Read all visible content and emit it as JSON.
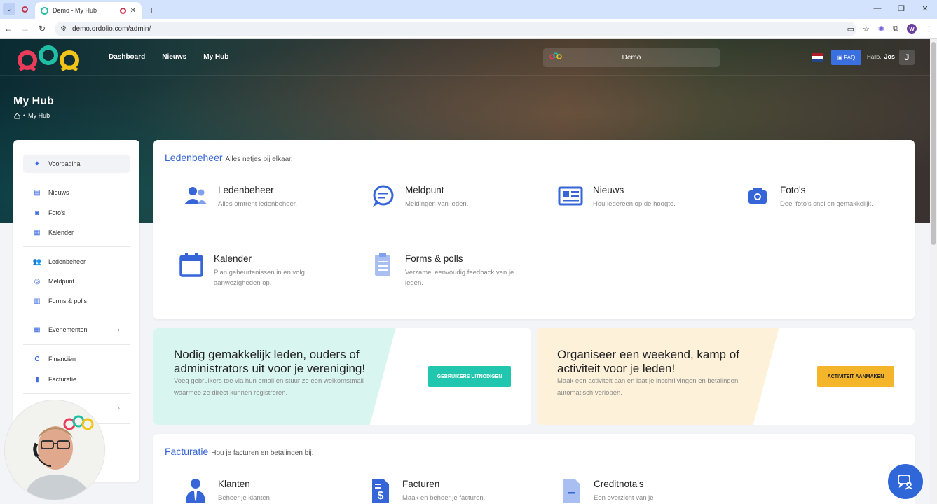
{
  "browser": {
    "tab_title": "Demo - My Hub",
    "url": "demo.ordolio.com/admin/",
    "profile_initial": "W"
  },
  "topnav": {
    "links": [
      "Dashboard",
      "Nieuws",
      "My Hub"
    ],
    "org_selector": "Demo",
    "faq_label": "FAQ",
    "greeting": "Hallo,",
    "username": "Jos",
    "user_initial": "J"
  },
  "page": {
    "title": "My Hub",
    "breadcrumb": "My Hub"
  },
  "sidebar": {
    "items": [
      {
        "label": "Voorpagina",
        "icon": "sparkle-icon"
      },
      {
        "label": "Nieuws",
        "icon": "newspaper-icon"
      },
      {
        "label": "Foto's",
        "icon": "camera-icon"
      },
      {
        "label": "Kalender",
        "icon": "calendar-icon"
      },
      {
        "label": "Ledenbeheer",
        "icon": "users-icon"
      },
      {
        "label": "Meldpunt",
        "icon": "chat-icon"
      },
      {
        "label": "Forms & polls",
        "icon": "clipboard-icon"
      },
      {
        "label": "Evenementen",
        "icon": "calendar-icon"
      },
      {
        "label": "Financiën",
        "icon": "coin-icon"
      },
      {
        "label": "Facturatie",
        "icon": "invoice-icon"
      }
    ]
  },
  "ledenbeheer_card": {
    "title": "Ledenbeheer",
    "subtitle": "Alles netjes bij elkaar.",
    "tiles": [
      {
        "title": "Ledenbeheer",
        "desc": "Alles omtrent ledenbeheer."
      },
      {
        "title": "Meldpunt",
        "desc": "Meldingen van leden."
      },
      {
        "title": "Nieuws",
        "desc": "Hou iedereen op de hoogte."
      },
      {
        "title": "Foto's",
        "desc": "Deel foto's snel en gemakkelijk."
      },
      {
        "title": "Kalender",
        "desc": "Plan gebeurtenissen in en volg aanwezigheden op."
      },
      {
        "title": "Forms & polls",
        "desc": "Verzamel eenvoudig feedback van je leden."
      }
    ]
  },
  "promo_invite": {
    "heading": "Nodig gemakkelijk leden, ouders of administrators uit voor je vereniging!",
    "text": "Voeg gebruikers toe via hun email en stuur ze een welkomstmail waarmee ze direct kunnen registreren.",
    "button": "GEBRUIKERS UITNODIGEN",
    "color": "#20c6ad"
  },
  "promo_activity": {
    "heading": "Organiseer een weekend, kamp of activiteit voor je leden!",
    "text": "Maak een activiteit aan en laat je inschrijvingen en betalingen automatisch verlopen.",
    "button": "ACTIVITEIT AANMAKEN",
    "color": "#f5b52b"
  },
  "facturatie_card": {
    "title": "Facturatie",
    "subtitle": "Hou je facturen en betalingen bij.",
    "tiles": [
      {
        "title": "Klanten",
        "desc": "Beheer je klanten."
      },
      {
        "title": "Facturen",
        "desc": "Maak en beheer je facturen."
      },
      {
        "title": "Creditnota's",
        "desc": "Een overzicht van je"
      }
    ]
  },
  "colors": {
    "accent": "#3565d6",
    "teal": "#20c6ad",
    "yellow": "#f5b52b",
    "brand_red": "#e83c5a"
  }
}
